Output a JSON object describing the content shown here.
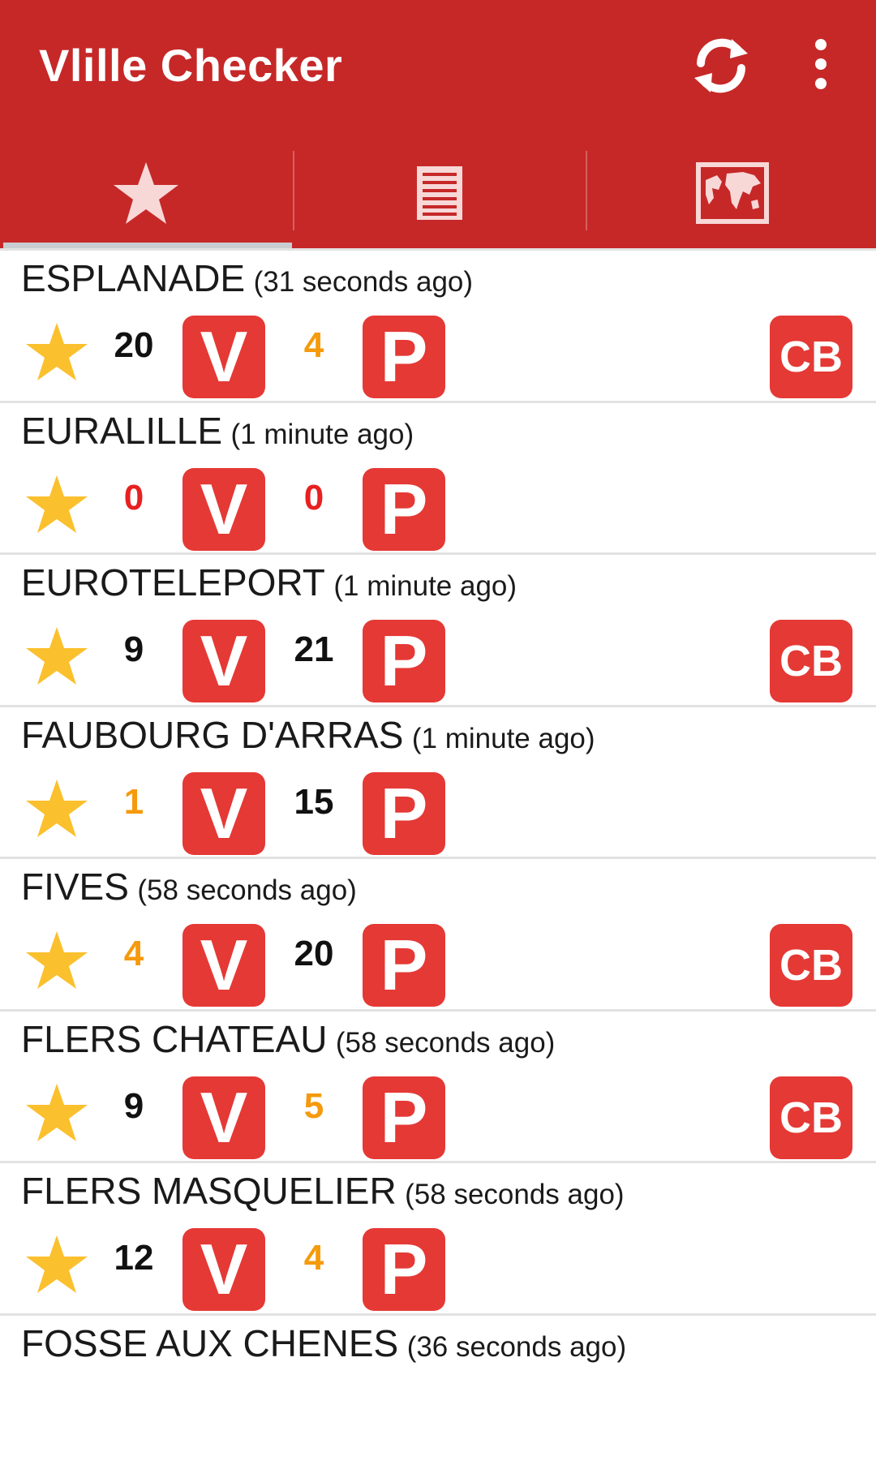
{
  "app": {
    "title": "Vlille Checker",
    "actions": {
      "refresh_icon": "refresh-icon",
      "overflow_icon": "more-vertical-icon"
    }
  },
  "tabs": [
    {
      "icon": "star-icon",
      "selected": true
    },
    {
      "icon": "list-icon",
      "selected": false
    },
    {
      "icon": "map-icon",
      "selected": false
    }
  ],
  "colors": {
    "primary": "#c62828",
    "badge": "#e53935",
    "star": "#fbc02d",
    "count_ok": "#111111",
    "count_low": "#f59a0c",
    "count_empty": "#e82020"
  },
  "stations": [
    {
      "name": "ESPLANADE",
      "updated": "(31 seconds ago)",
      "bikes": "20",
      "bikes_status": "ok",
      "bike_label": "V",
      "places": "4",
      "places_status": "low",
      "place_label": "P",
      "cb": "CB"
    },
    {
      "name": "EURALILLE",
      "updated": "(1 minute ago)",
      "bikes": "0",
      "bikes_status": "empty",
      "bike_label": "V",
      "places": "0",
      "places_status": "empty",
      "place_label": "P",
      "cb": ""
    },
    {
      "name": "EUROTELEPORT",
      "updated": "(1 minute ago)",
      "bikes": "9",
      "bikes_status": "ok",
      "bike_label": "V",
      "places": "21",
      "places_status": "ok",
      "place_label": "P",
      "cb": "CB"
    },
    {
      "name": "FAUBOURG D'ARRAS",
      "updated": "(1 minute ago)",
      "bikes": "1",
      "bikes_status": "low",
      "bike_label": "V",
      "places": "15",
      "places_status": "ok",
      "place_label": "P",
      "cb": ""
    },
    {
      "name": "FIVES",
      "updated": "(58 seconds ago)",
      "bikes": "4",
      "bikes_status": "low",
      "bike_label": "V",
      "places": "20",
      "places_status": "ok",
      "place_label": "P",
      "cb": "CB"
    },
    {
      "name": "FLERS CHATEAU",
      "updated": "(58 seconds ago)",
      "bikes": "9",
      "bikes_status": "ok",
      "bike_label": "V",
      "places": "5",
      "places_status": "low",
      "place_label": "P",
      "cb": "CB"
    },
    {
      "name": "FLERS MASQUELIER",
      "updated": "(58 seconds ago)",
      "bikes": "12",
      "bikes_status": "ok",
      "bike_label": "V",
      "places": "4",
      "places_status": "low",
      "place_label": "P",
      "cb": ""
    },
    {
      "name": "FOSSE AUX CHENES",
      "updated": "(36 seconds ago)",
      "bikes": "",
      "bikes_status": "ok",
      "bike_label": "",
      "places": "",
      "places_status": "ok",
      "place_label": "",
      "cb": ""
    }
  ]
}
